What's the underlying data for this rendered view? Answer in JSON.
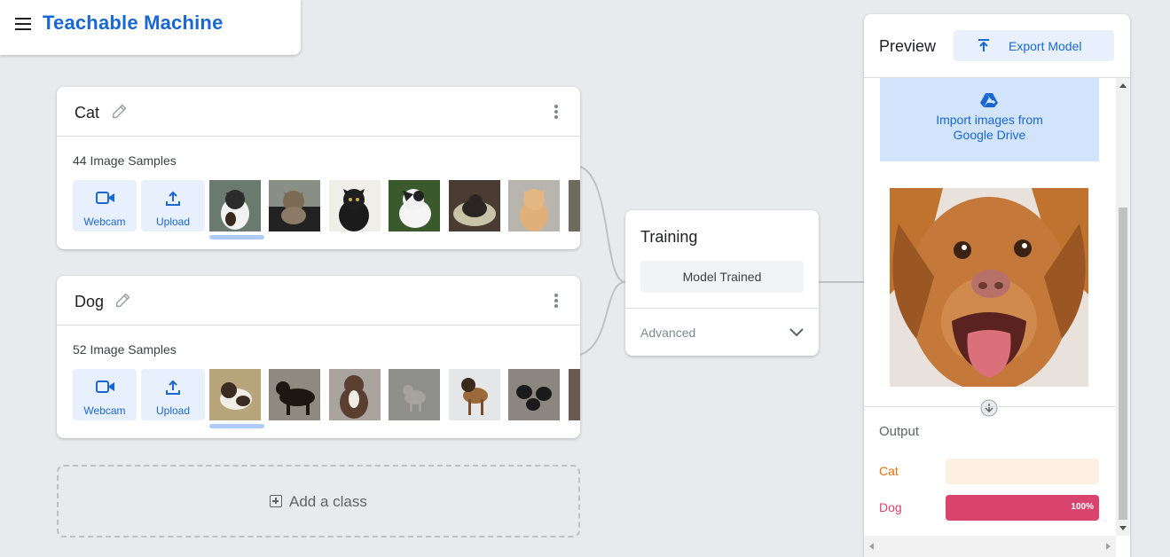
{
  "header": {
    "title": "Teachable Machine"
  },
  "classes": [
    {
      "name": "Cat",
      "samples_label": "44 Image Samples",
      "webcam_label": "Webcam",
      "upload_label": "Upload"
    },
    {
      "name": "Dog",
      "samples_label": "52 Image Samples",
      "webcam_label": "Webcam",
      "upload_label": "Upload"
    }
  ],
  "add_class_label": "Add a class",
  "training": {
    "title": "Training",
    "status_button": "Model Trained",
    "advanced_label": "Advanced"
  },
  "preview": {
    "title": "Preview",
    "export_label": "Export Model",
    "import_label": "Import images from Google Drive",
    "output_title": "Output",
    "outputs": [
      {
        "label": "Cat",
        "value": 0,
        "percent_text": "",
        "color": "#e8710a",
        "track": "#feefe3"
      },
      {
        "label": "Dog",
        "value": 100,
        "percent_text": "100%",
        "color": "#d9446d",
        "track": "#fce8ee"
      }
    ]
  },
  "colors": {
    "accent": "#1967d2",
    "accent_light": "#e8f0fe",
    "background": "#e8eaed"
  }
}
